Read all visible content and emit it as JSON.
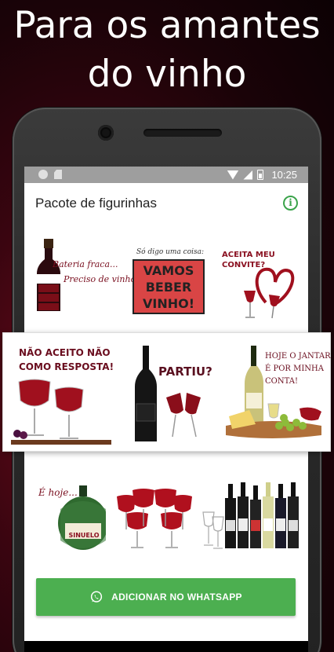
{
  "promo": {
    "line1": "Para os amantes",
    "line2": "do vinho"
  },
  "statusbar": {
    "time": "10:25"
  },
  "app": {
    "title": "Pacote de figurinhas"
  },
  "stickers": {
    "s1": {
      "line1": "Bateria fraca...",
      "line2": "Preciso de vinho!"
    },
    "s2": {
      "top": "Só digo uma coisa:",
      "line1": "VAMOS",
      "line2": "BEBER",
      "line3": "VINHO!"
    },
    "s3": {
      "line1": "ACEITA MEU",
      "line2": "CONVITE?"
    },
    "s4": {
      "line1": "NÃO ACEITO NÃO",
      "line2": "COMO RESPOSTA!"
    },
    "s5": {
      "line1": "PARTIU?"
    },
    "s6": {
      "line1": "HOJE O JANTAR",
      "line2": "É POR MINHA",
      "line3": "CONTA!"
    },
    "s7": {
      "line1": "É hoje...",
      "label": "SINUELO"
    }
  },
  "button": {
    "label": "ADICIONAR NO WHATSAPP"
  },
  "colors": {
    "wine": "#7a1020",
    "whatsapp_green": "#4caf50",
    "statusbar": "#9e9e9e",
    "info": "#3aa34a"
  }
}
